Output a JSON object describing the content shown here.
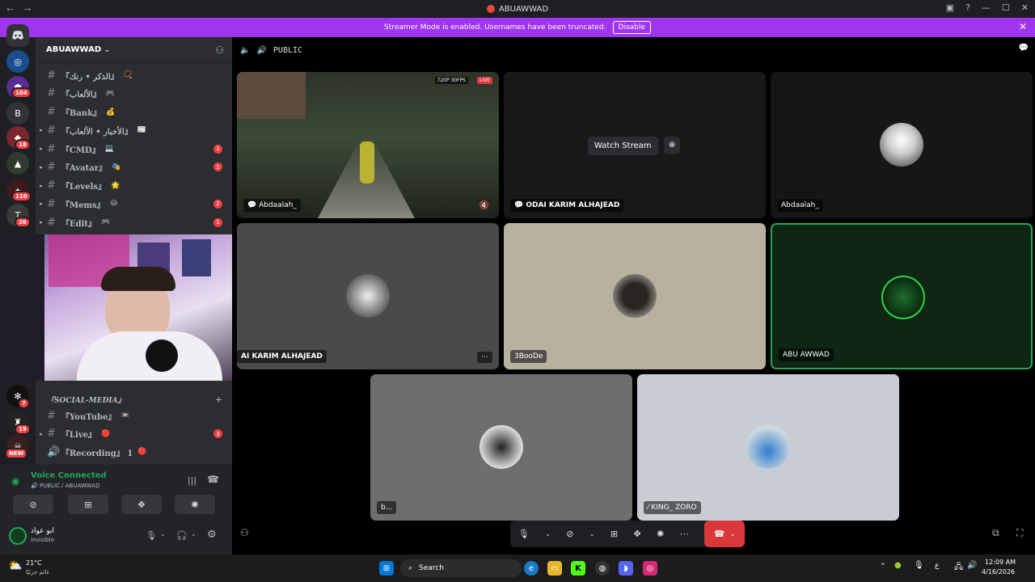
{
  "window": {
    "title": "ABUAWWAD"
  },
  "banner": {
    "text": "Streamer Mode is enabled. Usernames have been truncated.",
    "button": "Disable"
  },
  "rail": {
    "badges": [
      "104",
      "18",
      "110",
      "26",
      "7",
      "19"
    ],
    "letter": "B",
    "new_label": "NEW"
  },
  "server": {
    "name": "ABUAWWAD"
  },
  "channels": [
    {
      "name": "『الذكر • رنك』",
      "emoji": "📿",
      "arrow": false,
      "count": ""
    },
    {
      "name": "『الألعاب』",
      "emoji": "🎮",
      "arrow": false,
      "count": ""
    },
    {
      "name": "『Bank』",
      "emoji": "💰",
      "arrow": false,
      "count": ""
    },
    {
      "name": "『الأخبار • الألعاب』",
      "emoji": "📰",
      "arrow": true,
      "count": ""
    },
    {
      "name": "『CMD』",
      "emoji": "💻",
      "arrow": true,
      "count": "1"
    },
    {
      "name": "『Avatar』",
      "emoji": "🎭",
      "arrow": true,
      "count": "1"
    },
    {
      "name": "『Levels』",
      "emoji": "🌟",
      "arrow": true,
      "count": ""
    },
    {
      "name": "『Mems』",
      "emoji": "😂",
      "arrow": true,
      "count": "2"
    },
    {
      "name": "『Edit』",
      "emoji": "🎮",
      "arrow": true,
      "count": "1"
    }
  ],
  "category": {
    "name": "『SOCIAL-MEDIA』"
  },
  "channels2": [
    {
      "name": "『YouTube』",
      "emoji": "📼",
      "count": ""
    },
    {
      "name": "『Live』",
      "emoji": "🔴",
      "count": "3"
    },
    {
      "name": "『Recording』 1",
      "emoji": "🔴",
      "count": ""
    }
  ],
  "voice": {
    "status": "Voice Connected",
    "channel": "PUBLIC / ABUAWWAD"
  },
  "user": {
    "name": "ابو عواد",
    "status": "Invisible"
  },
  "main": {
    "channel": "PUBLIC"
  },
  "tiles": {
    "stream1": {
      "name": "Abdaalah_",
      "quality": "720P 30FPS",
      "live": "LIVE"
    },
    "stream2": {
      "name": "ODAI KARIM ALHAJEAD",
      "watch": "Watch Stream"
    },
    "t3": {
      "name": "Abdaalah_"
    },
    "t4": {
      "name": "AI KARIM ALHAJEAD"
    },
    "t5": {
      "name": "3BooDe"
    },
    "t6": {
      "name": "ABU AWWAD"
    },
    "t7": {
      "name": "b..."
    },
    "t8": {
      "name": "KING_ ZORO"
    }
  },
  "taskbar": {
    "weather_temp": "21°C",
    "weather_desc": "غائم جزئيًا",
    "search": "Search",
    "time": "12:09 AM",
    "date": "4/16/2026",
    "lang": "ع"
  },
  "colors": {
    "accent": "#a035f0",
    "green": "#23a55a",
    "red": "#da373c"
  }
}
